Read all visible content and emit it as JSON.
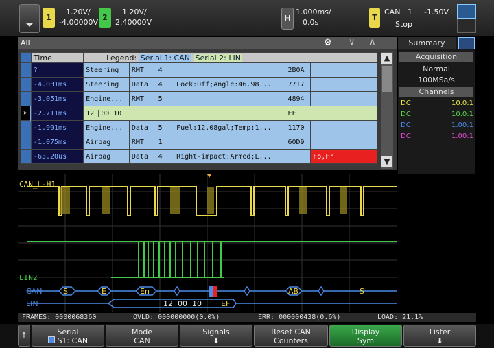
{
  "top": {
    "ch1": {
      "label": "1",
      "scale": "1.20V/",
      "offset": "-4.00000V"
    },
    "ch2": {
      "label": "2",
      "scale": "1.20V/",
      "offset": "2.40000V"
    },
    "horiz": {
      "label": "H",
      "scale": "1.000ms/",
      "delay": "0.0s"
    },
    "trigger": {
      "label": "T",
      "type": "CAN",
      "source": "1",
      "level": "-1.50V",
      "state": "Stop"
    }
  },
  "lister": {
    "title": "All",
    "time_header": "Time",
    "legend_label": "Legend:",
    "legend_serial1": "Serial 1: CAN",
    "legend_serial2": "Serial 2: LIN",
    "rows": [
      {
        "time": "?",
        "id": "Steering",
        "type": "RMT",
        "dlc": "4",
        "data": "",
        "crc": "2B0A",
        "err": ""
      },
      {
        "time": "-4.031ms",
        "id": "Steering",
        "type": "Data",
        "dlc": "4",
        "data": "Lock:Off;Angle:46.98...",
        "crc": "7717",
        "err": ""
      },
      {
        "time": "-3.051ms",
        "id": "Engine...",
        "type": "RMT",
        "dlc": "5",
        "data": "",
        "crc": "4894",
        "err": ""
      },
      {
        "time": "-2.711ms",
        "id": "12",
        "type": "00",
        "dlc": "10",
        "data": "",
        "crc": "",
        "err": "EF"
      },
      {
        "time": "-1.991ms",
        "id": "Engine...",
        "type": "Data",
        "dlc": "5",
        "data": "Fuel:12.08gal;Temp:1...",
        "crc": "1170",
        "err": ""
      },
      {
        "time": "-1.075ms",
        "id": "Airbag",
        "type": "RMT",
        "dlc": "1",
        "data": "",
        "crc": "60D9",
        "err": ""
      },
      {
        "time": "-63.20us",
        "id": "Airbag",
        "type": "Data",
        "dlc": "4",
        "data": "Right-impact:Armed;L...",
        "crc": "",
        "err": "Fo,Fr"
      }
    ]
  },
  "side": {
    "tab_summary": "Summary",
    "acq_header": "Acquisition",
    "acq_mode": "Normal",
    "acq_rate": "100MSa/s",
    "channels_header": "Channels",
    "channels": [
      {
        "coupling": "DC",
        "probe": "10.0:1",
        "color": "#e8e84a"
      },
      {
        "coupling": "DC",
        "probe": "10.0:1",
        "color": "#5ad84a"
      },
      {
        "coupling": "DC",
        "probe": "1.00:1",
        "color": "#4a8ae8"
      },
      {
        "coupling": "DC",
        "probe": "1.00:1",
        "color": "#e84ad8"
      }
    ]
  },
  "wave": {
    "ch1_label": "CAN_L-H1",
    "ch2_label": "LIN2",
    "s1_label": "CAN",
    "s2_label": "LIN",
    "can_packets": [
      "S",
      "E",
      "En",
      "AB",
      "S"
    ],
    "lin_text": "12  00  10",
    "lin_err": "EF"
  },
  "status": {
    "frames": "FRAMES: 0000068360",
    "ovld": "OVLD: 000000000(0.0%)",
    "err": "ERR: 000000438(0.6%)",
    "load": "LOAD: 21.1%"
  },
  "softkeys": [
    {
      "l1": "Serial",
      "l2": "S1: CAN"
    },
    {
      "l1": "Mode",
      "l2": "CAN"
    },
    {
      "l1": "Signals",
      "l2": ""
    },
    {
      "l1": "Reset CAN",
      "l2": "Counters"
    },
    {
      "l1": "Display",
      "l2": "Sym"
    },
    {
      "l1": "Lister",
      "l2": ""
    }
  ],
  "colors": {
    "ch1": "#e8d84a",
    "ch2": "#43c84a",
    "serial": "#4a8ae8",
    "error": "#e82020"
  }
}
